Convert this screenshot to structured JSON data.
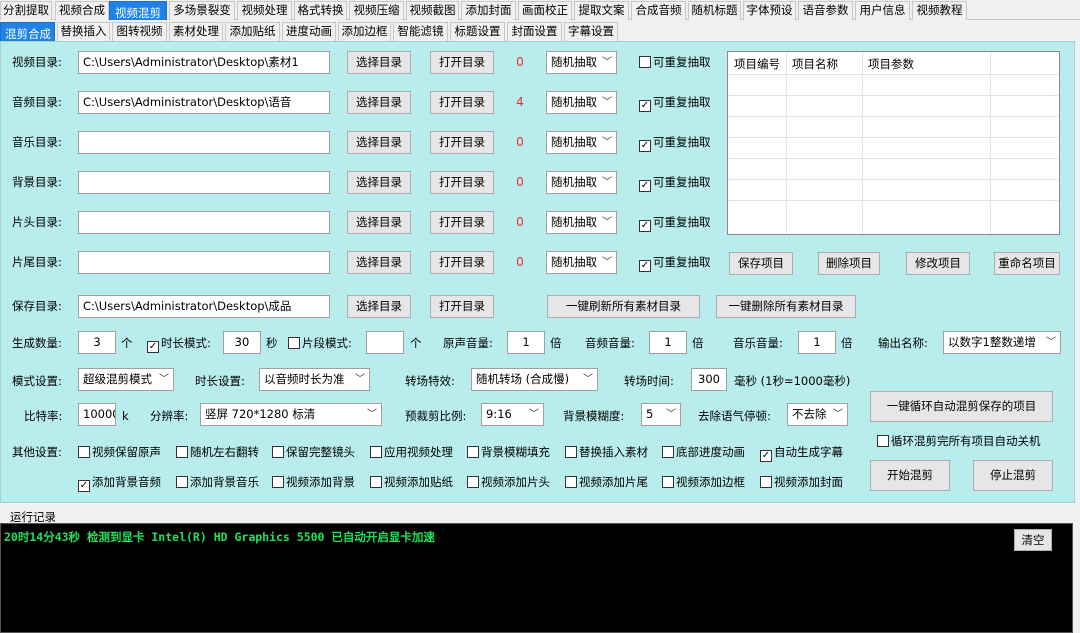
{
  "tabs_main": [
    "分割提取",
    "视频合成",
    "视频混剪",
    "多场景裂变",
    "视频处理",
    "格式转换",
    "视频压缩",
    "视频截图",
    "添加封面",
    "画面校正",
    "提取文案",
    "合成音频",
    "随机标题",
    "字体预设",
    "语音参数",
    "用户信息",
    "视频教程"
  ],
  "tabs_sub": [
    "混剪合成",
    "替换插入",
    "图转视频",
    "素材处理",
    "添加贴纸",
    "进度动画",
    "添加边框",
    "智能滤镜",
    "标题设置",
    "封面设置",
    "字幕设置"
  ],
  "dirs": [
    {
      "label": "视频目录:",
      "path": "C:\\Users\\Administrator\\Desktop\\素材1",
      "choose": "选择目录",
      "open": "打开目录",
      "count": "0",
      "mode": "随机抽取",
      "repeat": "可重复抽取",
      "checked": false
    },
    {
      "label": "音频目录:",
      "path": "C:\\Users\\Administrator\\Desktop\\语音",
      "choose": "选择目录",
      "open": "打开目录",
      "count": "4",
      "mode": "随机抽取",
      "repeat": "可重复抽取",
      "checked": true
    },
    {
      "label": "音乐目录:",
      "path": "",
      "choose": "选择目录",
      "open": "打开目录",
      "count": "0",
      "mode": "随机抽取",
      "repeat": "可重复抽取",
      "checked": true
    },
    {
      "label": "背景目录:",
      "path": "",
      "choose": "选择目录",
      "open": "打开目录",
      "count": "0",
      "mode": "随机抽取",
      "repeat": "可重复抽取",
      "checked": true
    },
    {
      "label": "片头目录:",
      "path": "",
      "choose": "选择目录",
      "open": "打开目录",
      "count": "0",
      "mode": "随机抽取",
      "repeat": "可重复抽取",
      "checked": true
    },
    {
      "label": "片尾目录:",
      "path": "",
      "choose": "选择目录",
      "open": "打开目录",
      "count": "0",
      "mode": "随机抽取",
      "repeat": "可重复抽取",
      "checked": true
    }
  ],
  "project_grid": {
    "headers": [
      "项目编号",
      "项目名称",
      "项目参数"
    ]
  },
  "project_buttons": [
    "保存项目",
    "删除项目",
    "修改项目",
    "重命名项目"
  ],
  "save_dir": {
    "label": "保存目录:",
    "path": "C:\\Users\\Administrator\\Desktop\\成品",
    "choose": "选择目录",
    "open": "打开目录"
  },
  "refresh_all": "一键刷新所有素材目录",
  "delete_all": "一键删除所有素材目录",
  "gen": {
    "count_label": "生成数量:",
    "count": "3",
    "count_unit": "个",
    "duration_mode": "时长模式:",
    "duration": "30",
    "duration_unit": "秒",
    "segment_mode": "片段模式:",
    "segment": "",
    "segment_unit": "个",
    "orig_vol_label": "原声音量:",
    "orig_vol": "1",
    "times": "倍",
    "audio_vol_label": "音频音量:",
    "audio_vol": "1",
    "music_vol_label": "音乐音量:",
    "music_vol": "1",
    "output_name_label": "输出名称:",
    "output_name": "以数字1整数递增"
  },
  "mode": {
    "mode_label": "模式设置:",
    "mode": "超级混剪模式",
    "dur_label": "时长设置:",
    "dur": "以音频时长为准",
    "trans_label": "转场特效:",
    "trans": "随机转场 (合成慢)",
    "trans_time_label": "转场时间:",
    "trans_time": "300",
    "trans_time_unit": "毫秒 (1秒=1000毫秒)"
  },
  "rate": {
    "bitrate_label": "比特率:",
    "bitrate": "10000",
    "bitrate_unit": "k",
    "res_label": "分辨率:",
    "res": "竖屏  720*1280    标清",
    "crop_label": "预裁剪比例:",
    "crop": "9:16",
    "blur_label": "背景模糊度:",
    "blur": "5",
    "pause_label": "去除语气停顿:",
    "pause": "不去除"
  },
  "loop_button": "一键循环自动混剪保存的项目",
  "auto_shutdown": "循环混剪完所有项目自动关机",
  "start": "开始混剪",
  "stop": "停止混剪",
  "other_label": "其他设置:",
  "options_row1": [
    {
      "t": "视频保留原声",
      "c": false
    },
    {
      "t": "随机左右翻转",
      "c": false
    },
    {
      "t": "保留完整镜头",
      "c": false
    },
    {
      "t": "应用视频处理",
      "c": false
    },
    {
      "t": "背景模糊填充",
      "c": false
    },
    {
      "t": "替换插入素材",
      "c": false
    },
    {
      "t": "底部进度动画",
      "c": false
    },
    {
      "t": "自动生成字幕",
      "c": true
    }
  ],
  "options_row2": [
    {
      "t": "添加背景音频",
      "c": true
    },
    {
      "t": "添加背景音乐",
      "c": false
    },
    {
      "t": "视频添加背景",
      "c": false
    },
    {
      "t": "视频添加贴纸",
      "c": false
    },
    {
      "t": "视频添加片头",
      "c": false
    },
    {
      "t": "视频添加片尾",
      "c": false
    },
    {
      "t": "视频添加边框",
      "c": false
    },
    {
      "t": "视频添加封面",
      "c": false
    }
  ],
  "log": {
    "title": "运行记录",
    "line": "20时14分43秒 检测到显卡 Intel(R) HD Graphics 5500 已自动开启显卡加速",
    "clear": "清空"
  }
}
